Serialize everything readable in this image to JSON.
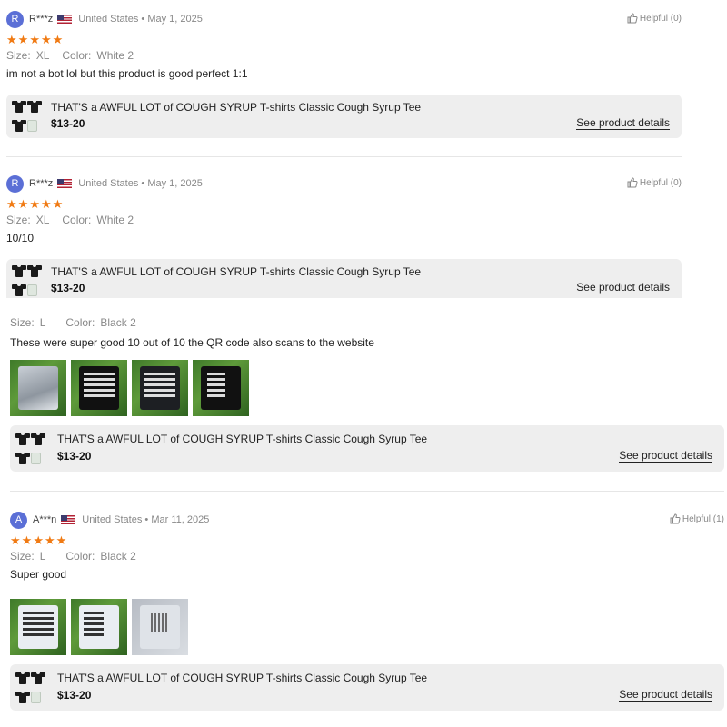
{
  "reviews": [
    {
      "avatar": "R",
      "user": "R***z",
      "location": "United States",
      "date": "May 1, 2025",
      "helpful": "Helpful (0)",
      "rating": 5,
      "size_label": "Size:",
      "size": "XL",
      "color_label": "Color:",
      "color": "White 2",
      "text": "im not a bot lol but this product is good perfect 1:1",
      "product": {
        "title": "THAT'S a AWFUL LOT of COUGH SYRUP T-shirts Classic Cough Syrup Tee",
        "price": "$13-20",
        "details": "See product details"
      }
    },
    {
      "avatar": "R",
      "user": "R***z",
      "location": "United States",
      "date": "May 1, 2025",
      "helpful": "Helpful (0)",
      "rating": 5,
      "size_label": "Size:",
      "size": "XL",
      "color_label": "Color:",
      "color": "White 2",
      "text": "10/10",
      "product": {
        "title": "THAT'S a AWFUL LOT of COUGH SYRUP T-shirts Classic Cough Syrup Tee",
        "price": "$13-20",
        "details": "See product details"
      }
    },
    {
      "size_label": "Size:",
      "size": "L",
      "color_label": "Color:",
      "color": "Black 2",
      "text": "These were super good 10 out of 10 the QR code also scans to the website",
      "photos": [
        "shirt-pile-photo",
        "black-warning-tee-photo",
        "white-warning-tee-photo",
        "black-print-tee-photo"
      ],
      "product": {
        "title": "THAT'S a AWFUL LOT of COUGH SYRUP T-shirts Classic Cough Syrup Tee",
        "price": "$13-20",
        "details": "See product details"
      }
    },
    {
      "avatar": "A",
      "user": "A***n",
      "location": "United States",
      "date": "Mar 11, 2025",
      "helpful": "Helpful (1)",
      "rating": 5,
      "size_label": "Size:",
      "size": "L",
      "color_label": "Color:",
      "color": "Black 2",
      "text": "Super good",
      "photos": [
        "white-warning-tee-photo",
        "white-print-tee-photo",
        "qr-tag-photo"
      ],
      "product": {
        "title": "THAT'S a AWFUL LOT of COUGH SYRUP T-shirts Classic Cough Syrup Tee",
        "price": "$13-20",
        "details": "See product details"
      }
    }
  ],
  "colors": {
    "star": "#f07a13",
    "avatar": "#5b6fd6",
    "card": "#eeeeee"
  },
  "icons": {
    "star": "star-icon",
    "helpful": "thumbs-up-icon",
    "flag": "us-flag-icon"
  }
}
